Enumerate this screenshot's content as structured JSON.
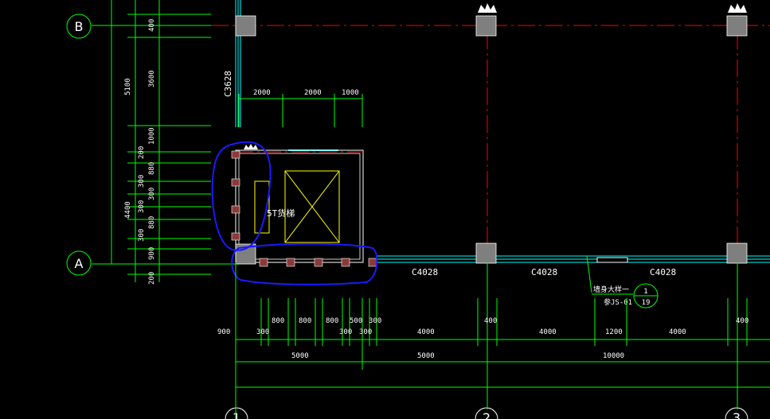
{
  "axes": {
    "row_b": "B",
    "row_a": "A",
    "col_1": "1",
    "col_2": "2",
    "col_3": "3"
  },
  "labels": {
    "window_c3628": "C3628",
    "window_c4028_a": "C4028",
    "window_c4028_b": "C4028",
    "window_c4028_c": "C4028",
    "elevator": "5T货梯",
    "detail_line1": "墙身大样一",
    "detail_line2": "参JS-01",
    "detail_num": "1",
    "detail_sheet": "19"
  },
  "dims_left": {
    "d400": "400",
    "d5100": "5100",
    "d3600": "3600",
    "d1000": "1000",
    "d200a": "200",
    "d880a": "880",
    "d300a": "300",
    "d300b": "300",
    "d300c": "300",
    "d880b": "880",
    "d300d": "300",
    "d900": "900",
    "d4400": "4400",
    "d200b": "200"
  },
  "dims_top": {
    "t2000a": "2000",
    "t2000b": "2000",
    "t1000": "1000"
  },
  "dims_bottom": {
    "b900": "900",
    "b300a": "300",
    "b800a": "800",
    "b800b": "800",
    "b800c": "800",
    "b500": "500",
    "b300b": "300",
    "b300c": "300",
    "b300d": "300",
    "b4000a": "4000",
    "b400a": "400",
    "b4000b": "4000",
    "b1200": "1200",
    "b4000c": "4000",
    "b400b": "400",
    "b5000a": "5000",
    "b5000b": "5000",
    "b10000": "10000"
  },
  "colors": {
    "background": "#000000",
    "dim_green": "#00ff00",
    "axis_red": "#ff0000",
    "wall_cyan": "#00ffff",
    "elevator_yellow": "#ffff00",
    "annotation_blue": "#1a1aff",
    "column_gray": "#808080"
  }
}
